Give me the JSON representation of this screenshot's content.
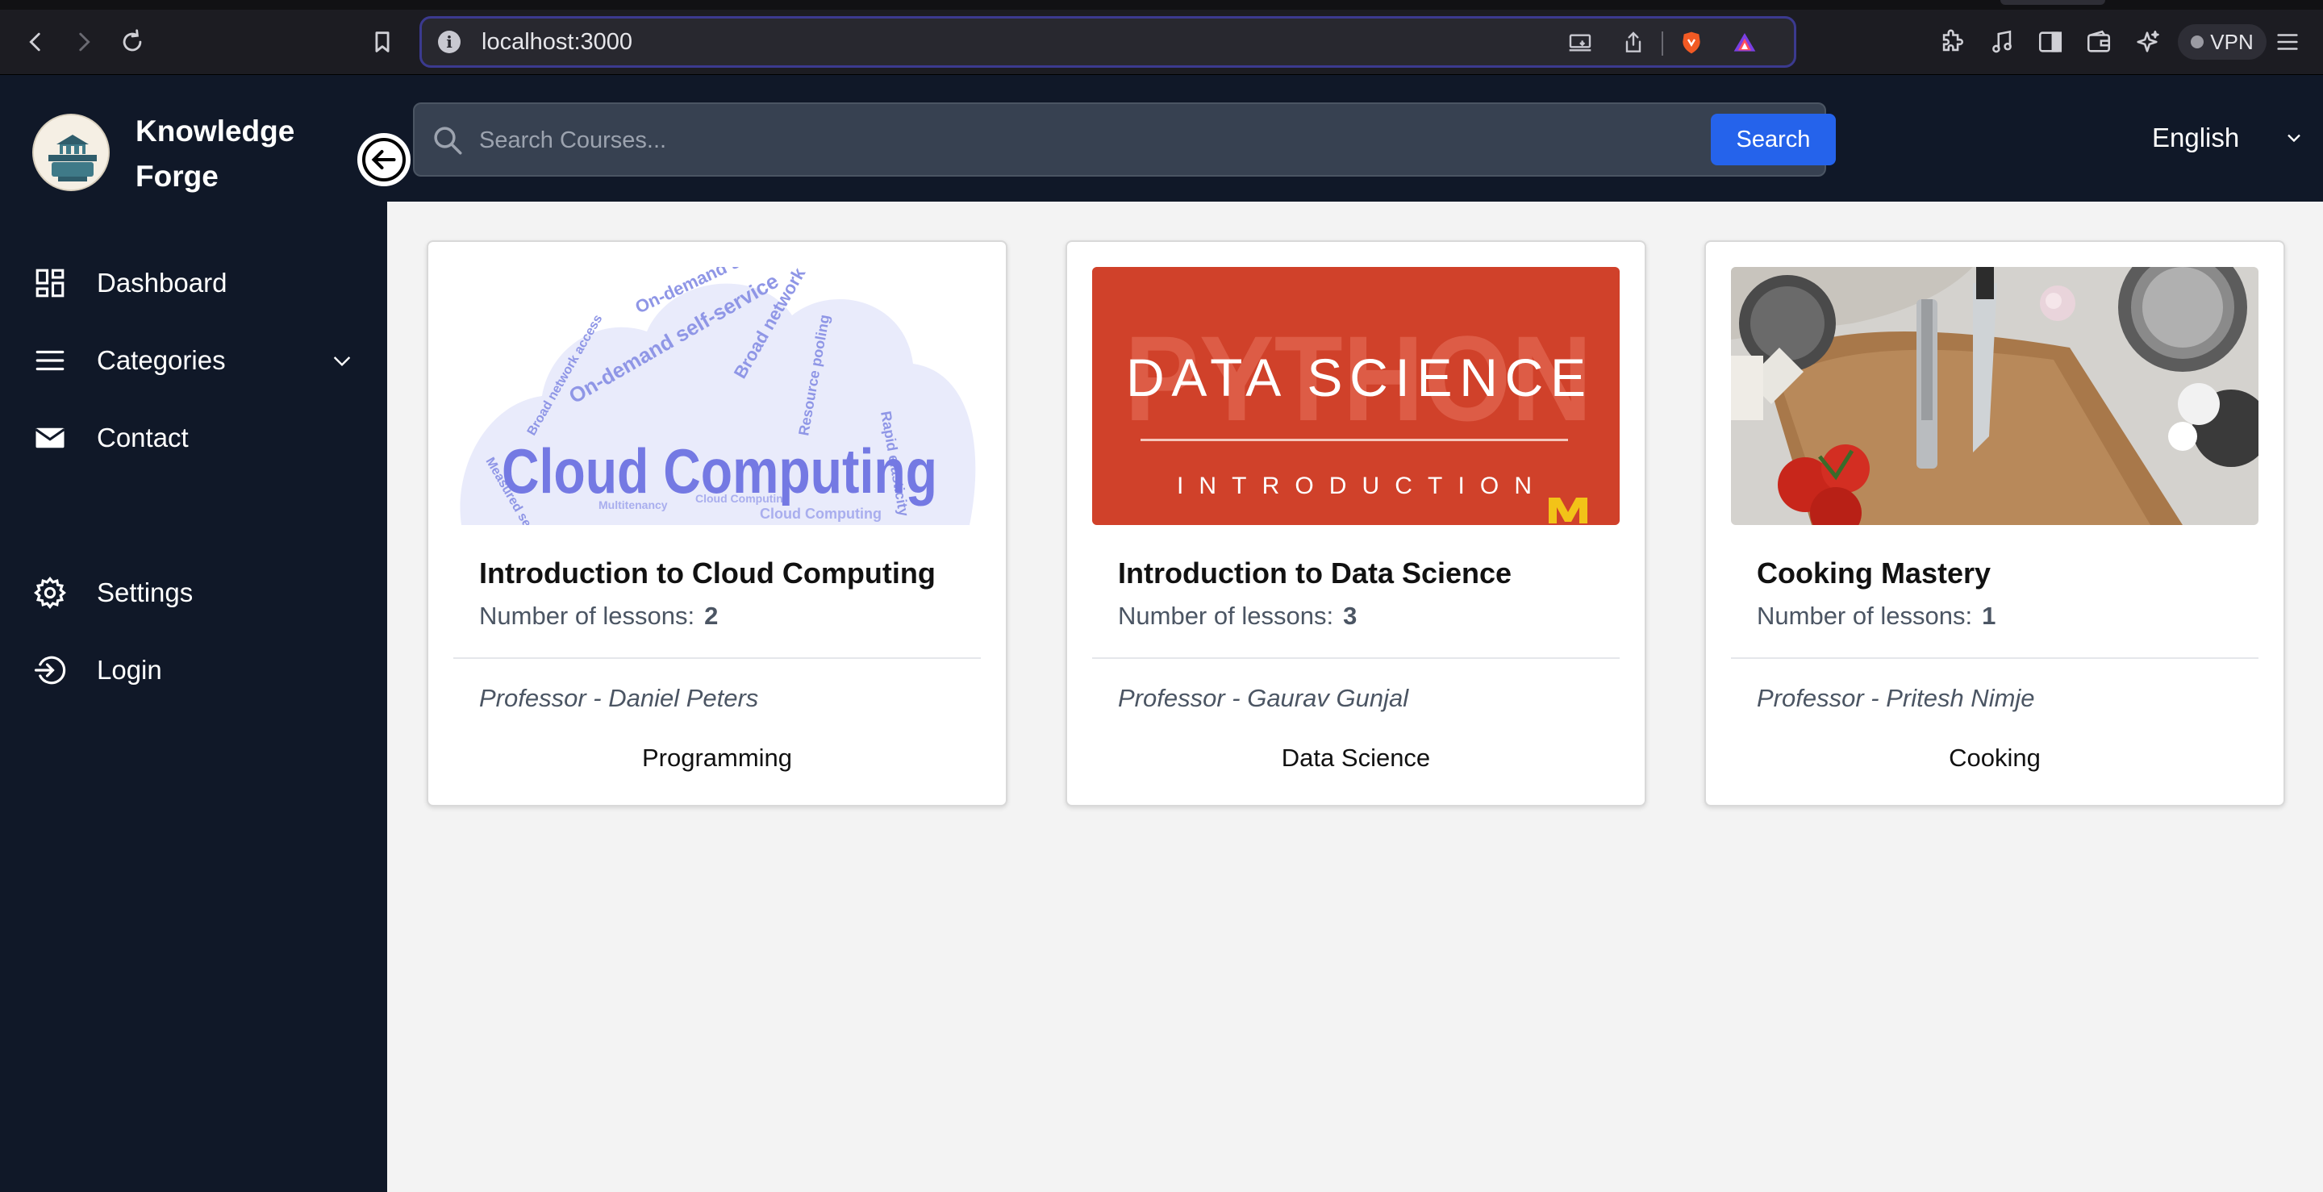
{
  "browser": {
    "url": "localhost:3000",
    "vpn_label": "VPN"
  },
  "sidebar": {
    "brand": "Knowledge Forge",
    "logo_text": "KNOWLEDGE FORGE",
    "items": [
      {
        "label": "Dashboard",
        "icon": "dashboard-icon"
      },
      {
        "label": "Categories",
        "icon": "menu-icon"
      },
      {
        "label": "Contact",
        "icon": "mail-icon"
      },
      {
        "label": "Settings",
        "icon": "gear-icon"
      },
      {
        "label": "Login",
        "icon": "login-icon"
      }
    ]
  },
  "header": {
    "search_placeholder": "Search Courses...",
    "search_button": "Search",
    "language": "English"
  },
  "courses": [
    {
      "title": "Introduction to Cloud Computing",
      "lessons_label": "Number of lessons:",
      "lessons": "2",
      "professor": "Professor - Daniel Peters",
      "category": "Programming",
      "image_text": "Cloud Computing"
    },
    {
      "title": "Introduction to Data Science",
      "lessons_label": "Number of lessons:",
      "lessons": "3",
      "professor": "Professor - Gaurav Gunjal",
      "category": "Data Science",
      "image_text_1": "DATA SCIENCE",
      "image_text_2": "INTRODUCTION"
    },
    {
      "title": "Cooking Mastery",
      "lessons_label": "Number of lessons:",
      "lessons": "1",
      "professor": "Professor - Pritesh Nimje",
      "category": "Cooking"
    }
  ],
  "colors": {
    "sidebar_bg": "#101828",
    "main_bg": "#f3f3f3",
    "accent": "#2563eb",
    "data_science_red": "#d8452d"
  }
}
